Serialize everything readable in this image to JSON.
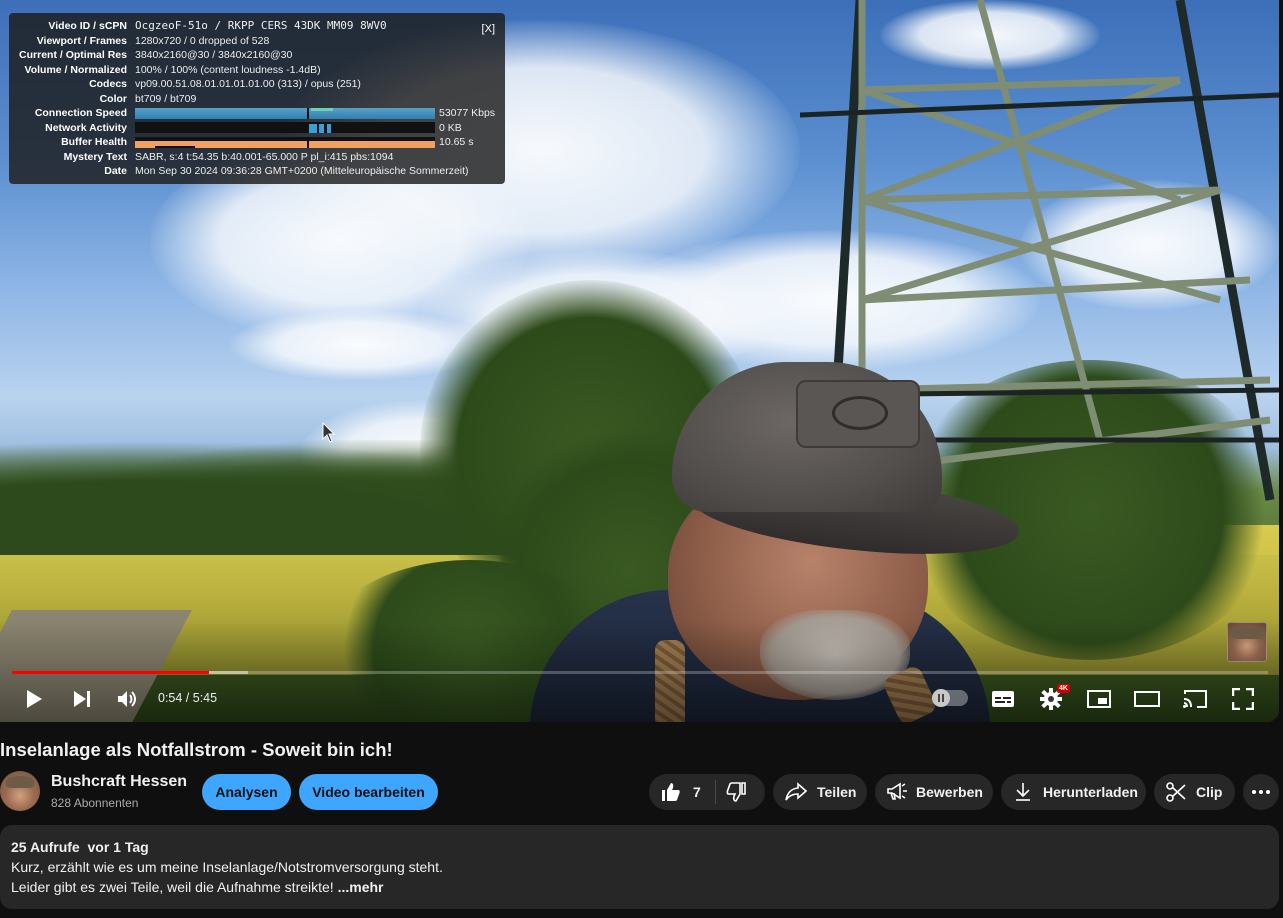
{
  "stats_for_nerds": {
    "rows": [
      {
        "label": "Video ID / sCPN",
        "value": "OcgzeoF-51o / RKPP CERS 43DK MM09 8WV0"
      },
      {
        "label": "Viewport / Frames",
        "value": "1280x720 / 0 dropped of 528"
      },
      {
        "label": "Current / Optimal Res",
        "value": "3840x2160@30 / 3840x2160@30"
      },
      {
        "label": "Volume / Normalized",
        "value": "100% / 100% (content loudness -1.4dB)"
      },
      {
        "label": "Codecs",
        "value": "vp09.00.51.08.01.01.01.01.00 (313) / opus (251)"
      },
      {
        "label": "Color",
        "value": "bt709 / bt709"
      }
    ],
    "connection_speed": {
      "label": "Connection Speed",
      "value": "53077 Kbps"
    },
    "network_activity": {
      "label": "Network Activity",
      "value": "0 KB"
    },
    "buffer_health": {
      "label": "Buffer Health",
      "value": "10.65 s"
    },
    "mystery_text": {
      "label": "Mystery Text",
      "value": "SABR, s:4 t:54.35 b:40.001-65.000 P pl_i:415 pbs:1094"
    },
    "date": {
      "label": "Date",
      "value": "Mon Sep 30 2024 09:36:28 GMT+0200 (Mitteleuropäische Sommerzeit)"
    },
    "close_label": "[X]"
  },
  "player": {
    "time_display": "0:54 / 5:45",
    "progress_played_fraction": 0.157,
    "progress_loaded_fraction": 0.188,
    "quality_badge": "4K",
    "icons": [
      "play-icon",
      "next-icon",
      "volume-icon",
      "autoplay-toggle",
      "subtitles-icon",
      "settings-icon",
      "miniplayer-icon",
      "theater-icon",
      "cast-icon",
      "fullscreen-icon"
    ]
  },
  "video": {
    "title": "Inselanlage als Notfallstrom - Soweit bin ich!",
    "channel_name": "Bushcraft Hessen",
    "subscribers": "828 Abonnenten"
  },
  "actions": {
    "analytics_label": "Analysen",
    "edit_label": "Video bearbeiten",
    "like_count": "7",
    "share_label": "Teilen",
    "promote_label": "Bewerben",
    "download_label": "Herunterladen",
    "clip_label": "Clip"
  },
  "description": {
    "meta": "25 Aufrufe  vor 1 Tag",
    "line1": "Kurz, erzählt wie es um meine Inselanlage/Notstromversorgung steht.",
    "line2": "Leider gibt es zwei Teile, weil die Aufnahme streikte! ",
    "more_label": "...mehr"
  },
  "colors": {
    "accent_blue": "#3ea6ff",
    "progress_red": "#ff0000",
    "background": "#0f0f0f",
    "chip": "#272727"
  }
}
